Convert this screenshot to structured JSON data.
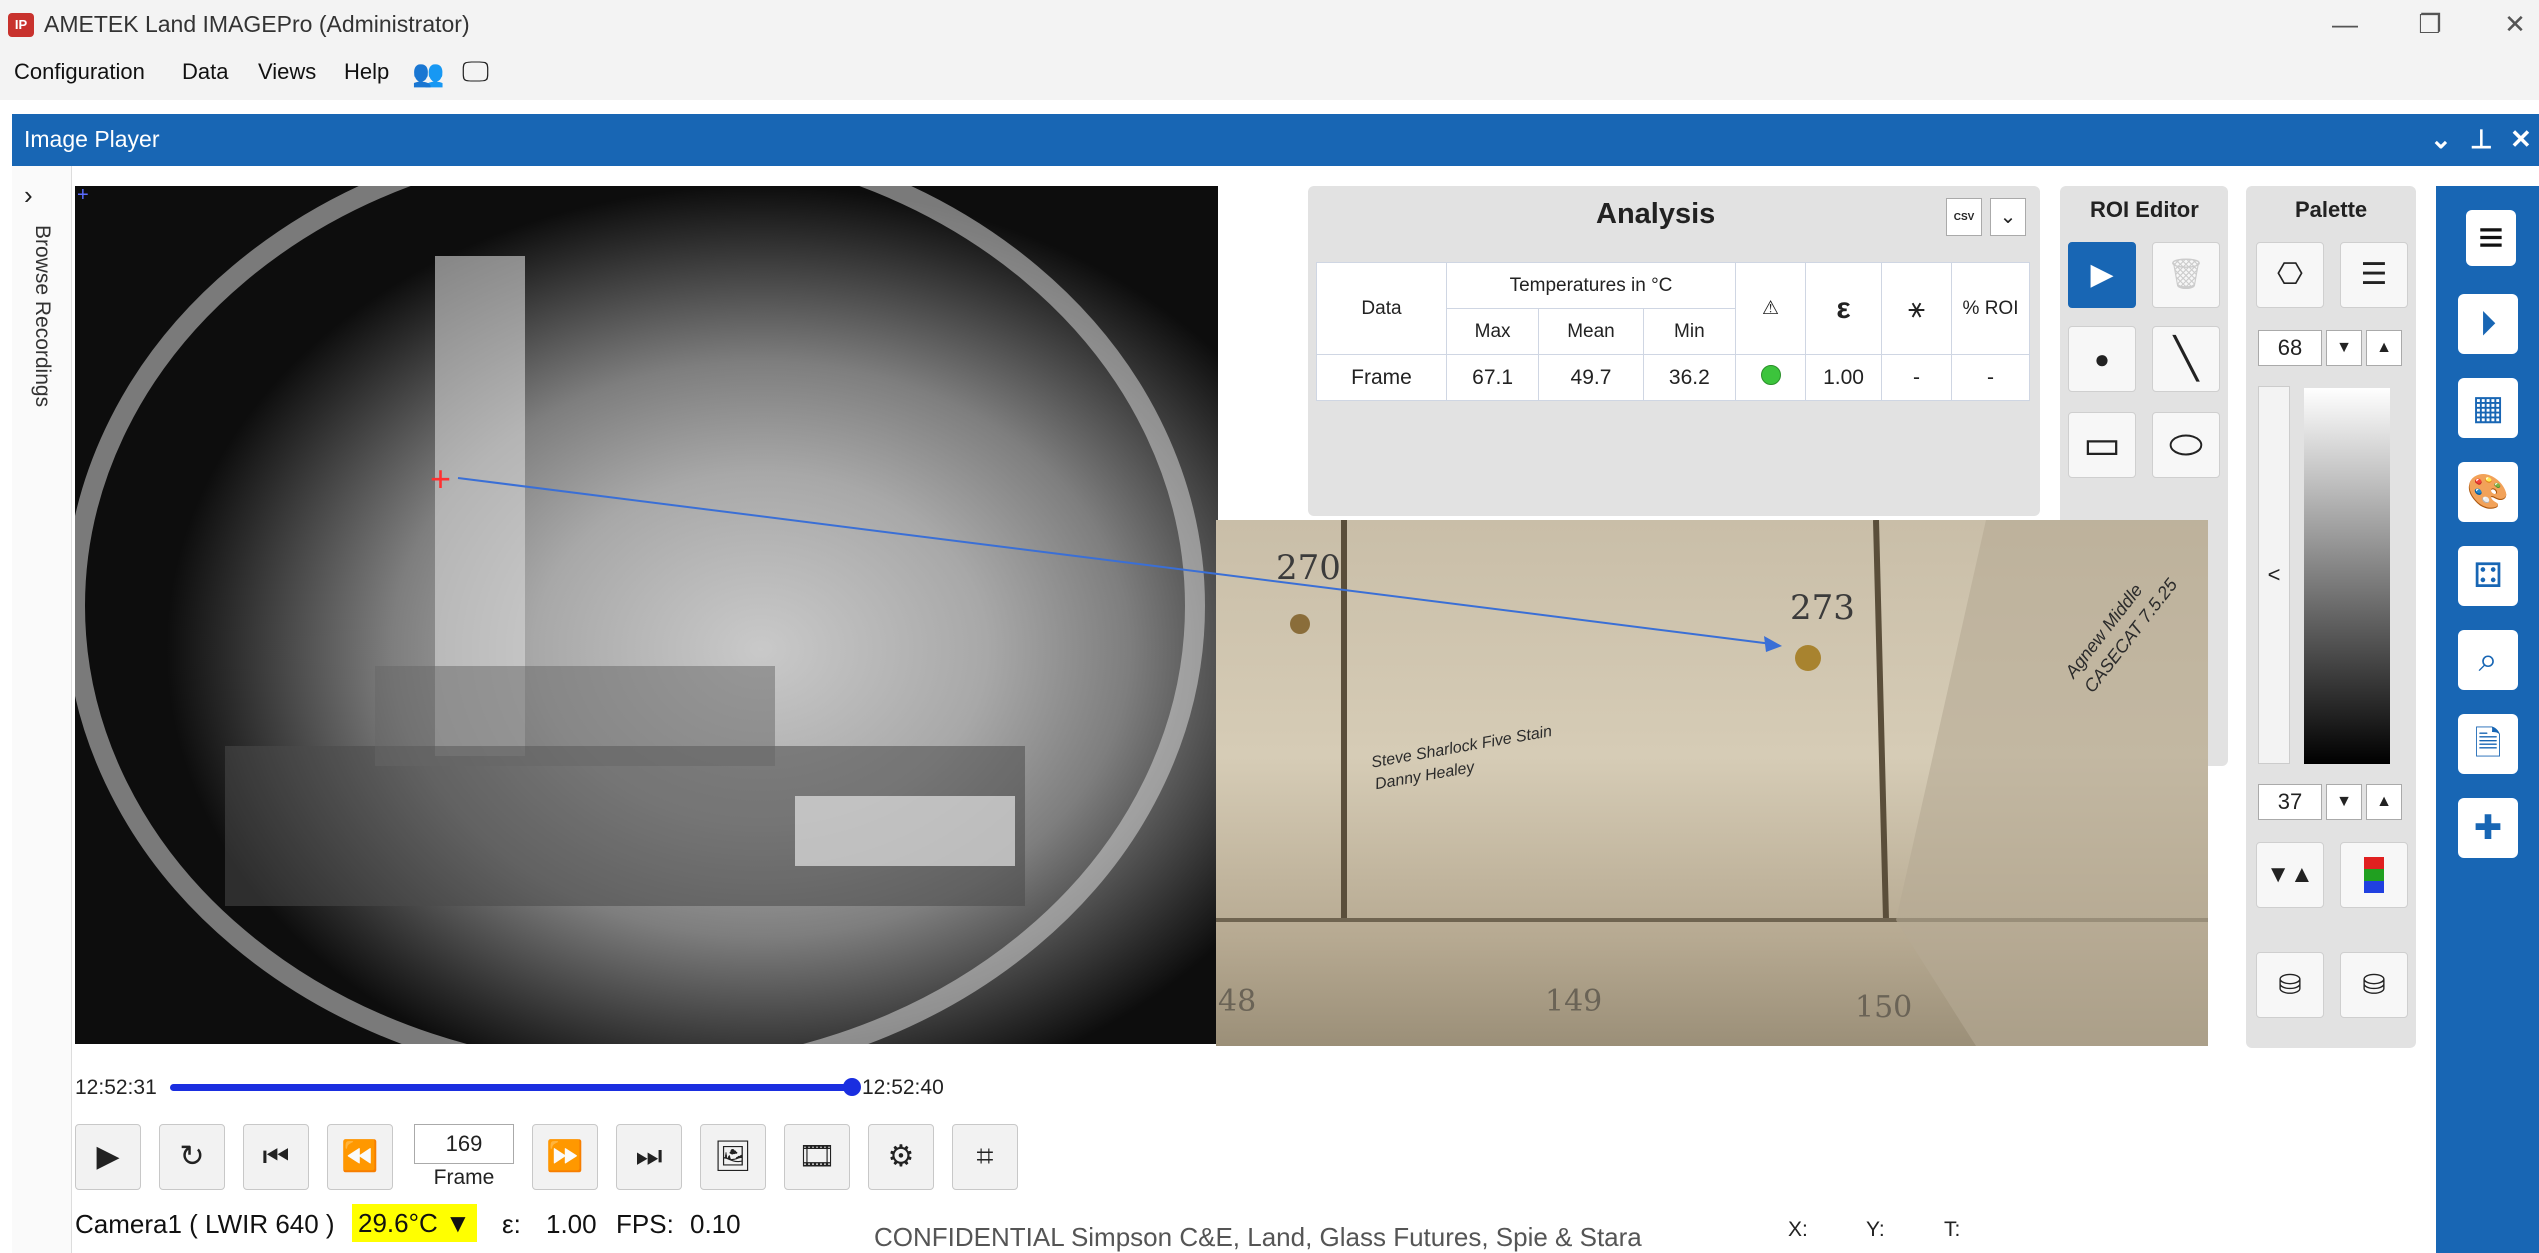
{
  "window": {
    "title": "AMETEK Land IMAGEPro (Administrator)",
    "icon_text": "IP"
  },
  "menu": [
    "Configuration",
    "Data",
    "Views",
    "Help"
  ],
  "panel": {
    "title": "Image Player",
    "browse_label": "Browse Recordings"
  },
  "analysis": {
    "title": "Analysis",
    "export_badge": "CSV",
    "group_header": "Temperatures in °C",
    "col_data": "Data",
    "col_max": "Max",
    "col_mean": "Mean",
    "col_min": "Min",
    "col_emissivity": "ε",
    "col_roi": "% ROI",
    "row": {
      "label": "Frame",
      "max": "67.1",
      "mean": "49.7",
      "min": "36.2",
      "emissivity": "1.00",
      "col7": "-",
      "roi": "-"
    }
  },
  "roi_editor": {
    "title": "ROI Editor"
  },
  "palette": {
    "title": "Palette",
    "max_value": "68",
    "min_value": "37",
    "collapse": "<"
  },
  "timeline": {
    "start": "12:52:31",
    "end": "12:52:40",
    "progress": 1.0
  },
  "playback": {
    "frame_value": "169",
    "frame_label": "Frame"
  },
  "status": {
    "camera": "Camera1 ( LWIR 640 )",
    "temp": "29.6°C",
    "emissivity_label": "ε:",
    "emissivity": "1.00",
    "fps_label": "FPS:",
    "fps": "0.10",
    "x_label": "X:",
    "y_label": "Y:",
    "t_label": "T:"
  },
  "watermark": "CONFIDENTIAL Simpson C&E, Land, Glass Futures, Spie & Stara",
  "photo": {
    "labels": [
      "270",
      "273",
      "48",
      "149",
      "150"
    ],
    "handwriting_1": "Steve Sharlock Five Stain Danny Healey",
    "handwriting_2": "Agnew Middle CASECAT 7.5.25"
  },
  "colors": {
    "accent": "#1866b4",
    "highlight": "#ffff00",
    "ok": "#3cc43c"
  }
}
